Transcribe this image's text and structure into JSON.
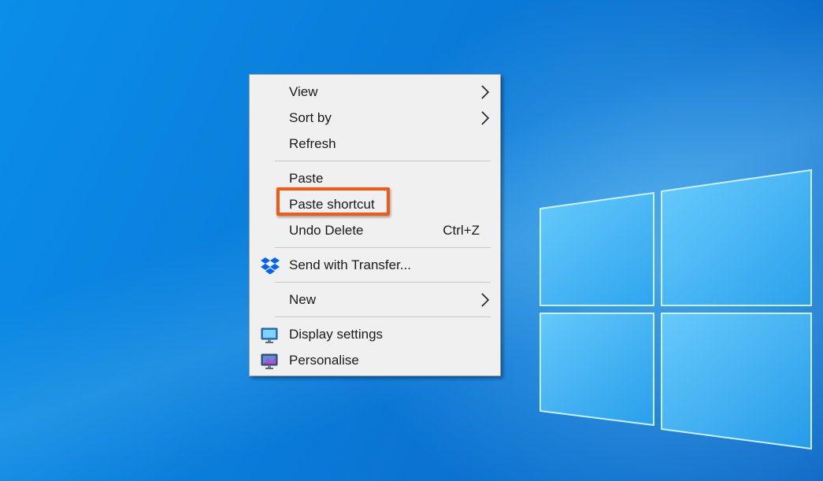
{
  "menu": {
    "items": {
      "view": {
        "label": "View",
        "icon": "chevron-right-icon"
      },
      "sort_by": {
        "label": "Sort by",
        "icon": "chevron-right-icon"
      },
      "refresh": {
        "label": "Refresh"
      },
      "paste": {
        "label": "Paste"
      },
      "paste_shortcut": {
        "label": "Paste shortcut",
        "highlighted": true,
        "highlight_color": "#f05a14"
      },
      "undo_delete": {
        "label": "Undo Delete",
        "shortcut": "Ctrl+Z"
      },
      "send_with_transfer": {
        "label": "Send with Transfer...",
        "icon": "dropbox-icon",
        "icon_color": "#0061fe"
      },
      "new": {
        "label": "New",
        "icon": "chevron-right-icon"
      },
      "display_settings": {
        "label": "Display settings",
        "icon": "display-settings-icon"
      },
      "personalise": {
        "label": "Personalise",
        "icon": "personalise-icon"
      }
    }
  },
  "colors": {
    "desktop_blue": "#0a7fdc",
    "menu_background": "#f0f0f0",
    "menu_text": "#1a1a1a",
    "separator": "#c8c8c8"
  }
}
